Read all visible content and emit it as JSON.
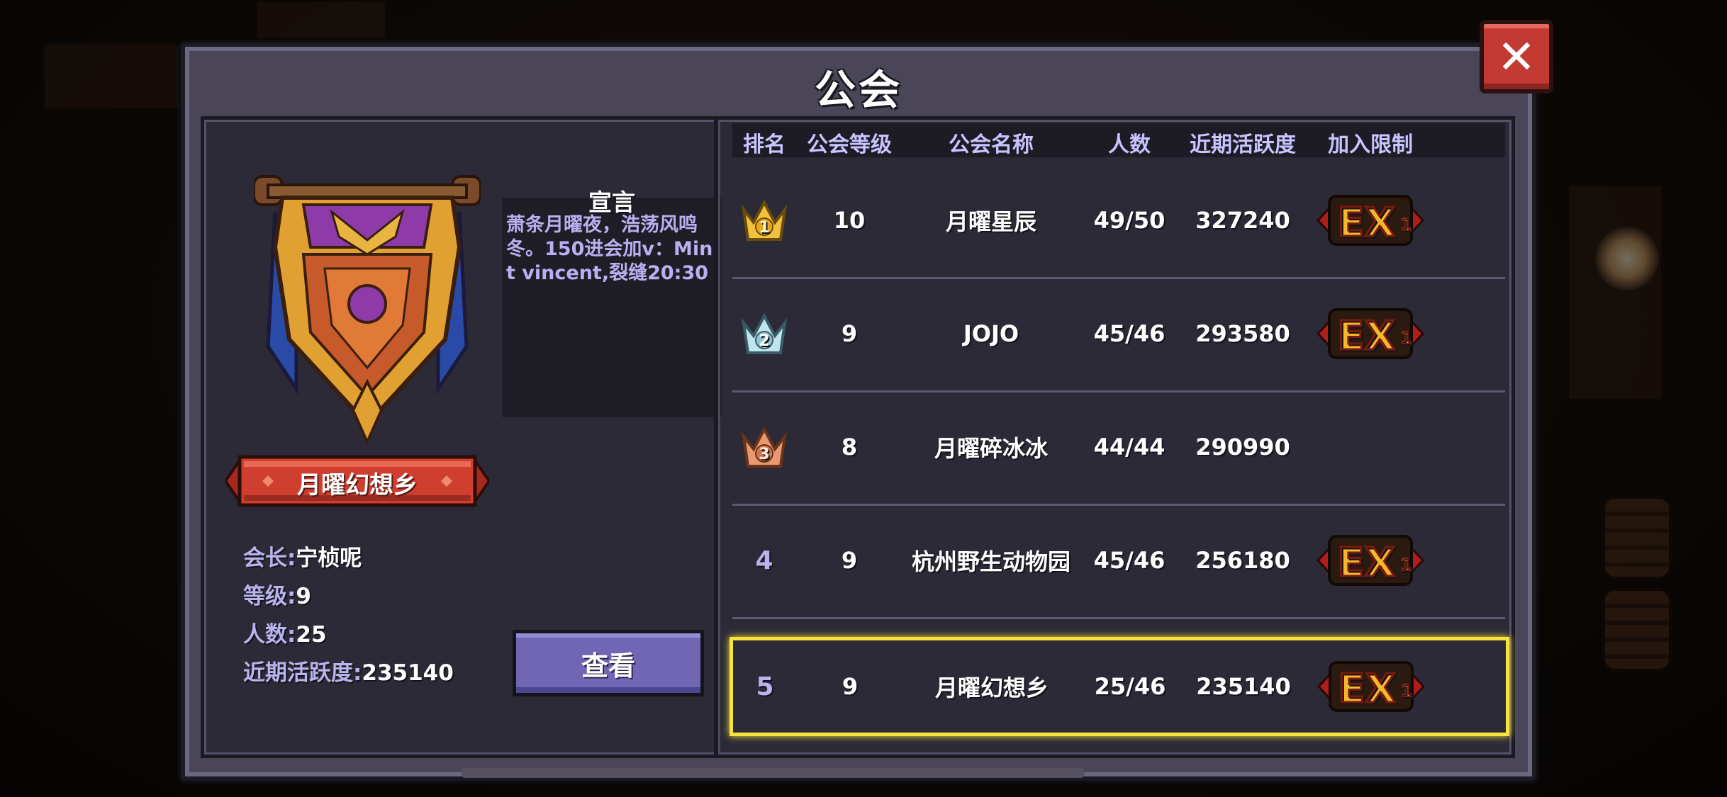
{
  "window": {
    "title": "公会"
  },
  "guild_detail": {
    "name": "月曜幻想乡",
    "leader_label": "会长:",
    "leader_value": "宁桢呢",
    "level_label": "等级:",
    "level_value": "9",
    "members_label": "人数:",
    "members_value": "25",
    "activity_label": "近期活跃度:",
    "activity_value": "235140",
    "manifesto_title": "宣言",
    "manifesto_text": "萧条月曜夜，浩荡风鸣冬。150进会加v：Mint vincent,裂缝20:30",
    "view_button": "查看"
  },
  "table": {
    "headers": [
      "排名",
      "公会等级",
      "公会名称",
      "人数",
      "近期活跃度",
      "加入限制"
    ],
    "rows": [
      {
        "rank": "1",
        "rank_icon": "gold-crown-icon",
        "level": "10",
        "name": "月曜星辰",
        "members": "49/50",
        "activity": "327240",
        "restriction": "EX",
        "restriction_level": "1"
      },
      {
        "rank": "2",
        "rank_icon": "silver-crown-icon",
        "level": "9",
        "name": "JOJO",
        "members": "45/46",
        "activity": "293580",
        "restriction": "EX",
        "restriction_level": "1"
      },
      {
        "rank": "3",
        "rank_icon": "bronze-crown-icon",
        "level": "8",
        "name": "月曜碎冰冰",
        "members": "44/44",
        "activity": "290990",
        "restriction": "",
        "restriction_level": ""
      },
      {
        "rank": "4",
        "rank_icon": "",
        "level": "9",
        "name": "杭州野生动物园",
        "members": "45/46",
        "activity": "256180",
        "restriction": "EX",
        "restriction_level": "1"
      },
      {
        "rank": "5",
        "rank_icon": "",
        "level": "9",
        "name": "月曜幻想乡",
        "members": "25/46",
        "activity": "235140",
        "restriction": "EX",
        "restriction_level": "1"
      }
    ]
  },
  "colors": {
    "panel": "#4a4658",
    "inner": "#2c2a37",
    "header_text": "#c9c3ff",
    "selection": "#f6e33d",
    "close_button": "#c33a33",
    "view_button": "#7066b3"
  }
}
